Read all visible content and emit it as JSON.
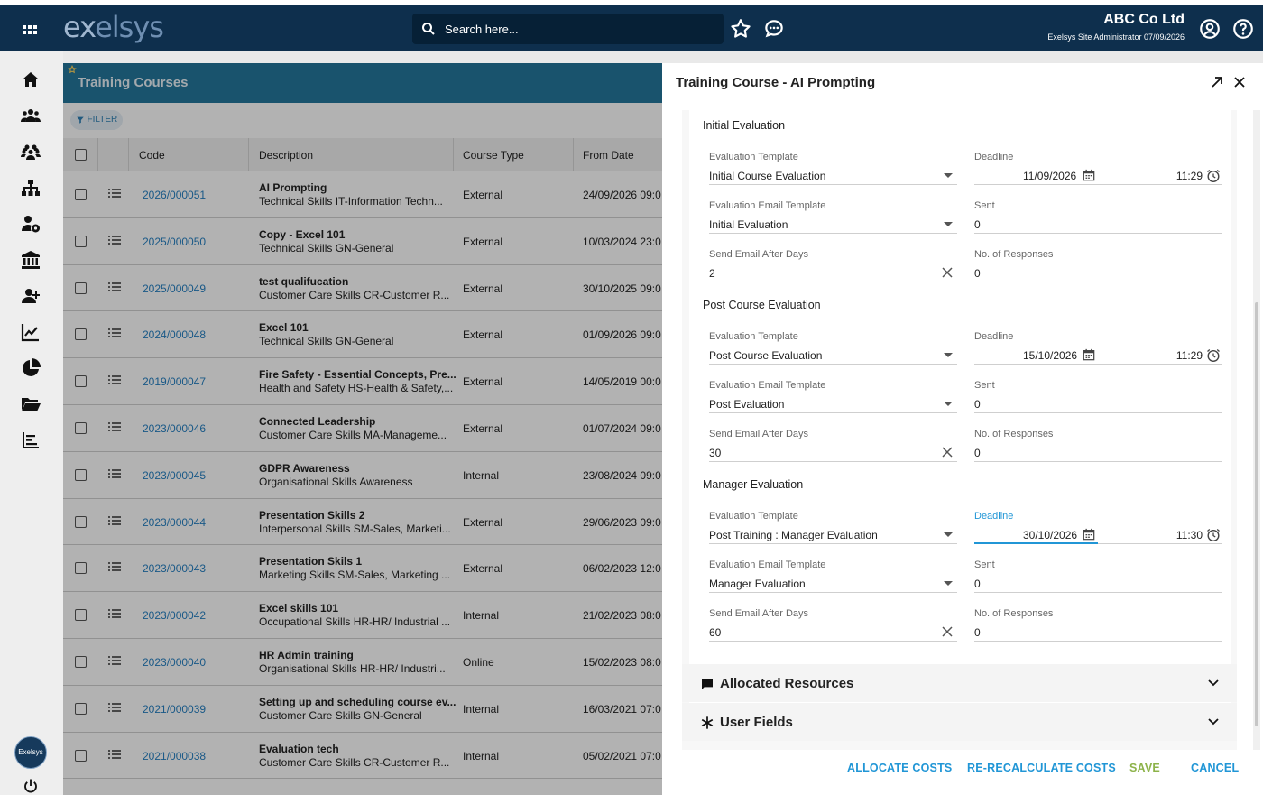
{
  "app": {
    "logo_ex": "ex",
    "logo_elsys": "elsys"
  },
  "search": {
    "placeholder": "Search here..."
  },
  "company": {
    "name": "ABC Co Ltd",
    "user_line": "Exelsys Site Administrator 07/09/2026"
  },
  "rail": {
    "avatar_label": "Exelsys"
  },
  "list": {
    "title": "Training Courses",
    "filter_label": "FILTER",
    "columns": [
      "Code",
      "Description",
      "Course Type",
      "From Date"
    ],
    "rows": [
      {
        "code": "2026/000051",
        "title": "AI Prompting",
        "sub": "Technical Skills IT-Information Techn...",
        "type": "External",
        "from": "24/09/2026 09:0"
      },
      {
        "code": "2025/000050",
        "title": "Copy - Excel 101",
        "sub": "Technical Skills GN-General",
        "type": "External",
        "from": "10/03/2024 23:0"
      },
      {
        "code": "2025/000049",
        "title": "test qualifucation",
        "sub": "Customer Care Skills CR-Customer R...",
        "type": "External",
        "from": "30/10/2025 09:0"
      },
      {
        "code": "2024/000048",
        "title": "Excel 101",
        "sub": "Technical Skills GN-General",
        "type": "External",
        "from": "01/09/2026 09:0"
      },
      {
        "code": "2019/000047",
        "title": "Fire Safety - Essential Concepts, Pre...",
        "sub": "Health and Safety HS-Health & Safety,...",
        "type": "External",
        "from": "14/05/2019 00:0"
      },
      {
        "code": "2023/000046",
        "title": "Connected Leadership",
        "sub": "Customer Care Skills MA-Manageme...",
        "type": "External",
        "from": "01/07/2024 09:0"
      },
      {
        "code": "2023/000045",
        "title": "GDPR Awareness",
        "sub": "Organisational Skills Awareness",
        "type": "Internal",
        "from": "23/08/2024 09:0"
      },
      {
        "code": "2023/000044",
        "title": "Presentation Skills 2",
        "sub": "Interpersonal Skills SM-Sales, Marketi...",
        "type": "External",
        "from": "29/06/2023 09:0"
      },
      {
        "code": "2023/000043",
        "title": "Presentation Skils 1",
        "sub": "Marketing Skills SM-Sales, Marketing ...",
        "type": "External",
        "from": "06/02/2023 12:0"
      },
      {
        "code": "2023/000042",
        "title": "Excel skills 101",
        "sub": "Occupational Skills HR-HR/ Industrial ...",
        "type": "Internal",
        "from": "21/02/2023 08:0"
      },
      {
        "code": "2023/000040",
        "title": "HR Admin training",
        "sub": "Organisational Skills HR-HR/ Industri...",
        "type": "Online",
        "from": "15/02/2023 08:0"
      },
      {
        "code": "2021/000039",
        "title": "Setting up and scheduling course ev...",
        "sub": "Customer Care Skills GN-General",
        "type": "Internal",
        "from": "16/03/2021 07:0"
      },
      {
        "code": "2021/000038",
        "title": "Evaluation tech",
        "sub": "Customer Care Skills CR-Customer R...",
        "type": "Internal",
        "from": "05/02/2021 07:0"
      }
    ]
  },
  "detail": {
    "title": "Training Course - AI Prompting",
    "labels": {
      "eval_template": "Evaluation Template",
      "email_template": "Evaluation Email Template",
      "send_after": "Send Email After Days",
      "deadline": "Deadline",
      "sent": "Sent",
      "responses": "No. of Responses"
    },
    "sections": [
      {
        "title": "Initial Evaluation",
        "eval_template": "Initial Course Evaluation",
        "email_template": "Initial Evaluation",
        "send_after": "2",
        "deadline_date": "11/09/2026",
        "deadline_time": "11:29",
        "sent": "0",
        "responses": "0"
      },
      {
        "title": "Post Course Evaluation",
        "eval_template": "Post Course Evaluation",
        "email_template": "Post Evaluation",
        "send_after": "30",
        "deadline_date": "15/10/2026",
        "deadline_time": "11:29",
        "sent": "0",
        "responses": "0"
      },
      {
        "title": "Manager Evaluation",
        "eval_template": "Post Training : Manager Evaluation",
        "email_template": "Manager Evaluation",
        "send_after": "60",
        "deadline_date": "30/10/2026",
        "deadline_time": "11:30",
        "sent": "0",
        "responses": "0"
      }
    ],
    "accordions": {
      "resources": "Allocated Resources",
      "user_fields": "User Fields"
    },
    "buttons": {
      "allocate": "ALLOCATE COSTS",
      "recalc": "RE-RECALCULATE COSTS",
      "save": "SAVE",
      "cancel": "CANCEL"
    }
  },
  "colors": {
    "topbar": "#0e2f4d",
    "list_header": "#24779d",
    "link": "#2680c2",
    "action_blue": "#2196d6",
    "save_green": "#8db34a"
  },
  "icons": [
    "apps-grid-icon",
    "search-icon",
    "star-icon",
    "chat-icon",
    "account-icon",
    "help-icon",
    "home-icon",
    "people-icon",
    "org-chart-icon",
    "person-settings-icon",
    "bank-icon",
    "add-person-icon",
    "line-chart-icon",
    "pie-chart-icon",
    "folder-icon",
    "bar-list-icon",
    "power-icon",
    "filter-icon",
    "row-menu-icon",
    "expand-icon",
    "close-icon",
    "calendar-icon",
    "clock-icon",
    "clear-icon",
    "comment-icon",
    "asterisk-icon",
    "chevron-down-icon"
  ]
}
